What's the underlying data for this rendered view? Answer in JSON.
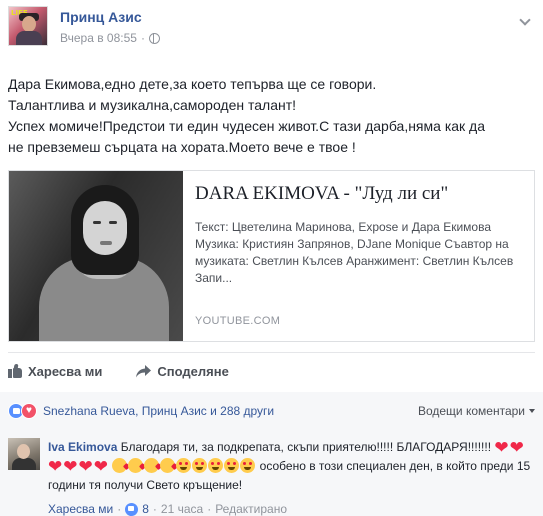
{
  "post": {
    "author": "Принц Азис",
    "timestamp": "Вчера в 08:55",
    "audience_icon": "globe-icon",
    "text_lines": [
      "Дара Екимова,едно дете,за което тепърва ще се говори.",
      "Талантлива и музикална,самороден талант!",
      "Успех момиче!Предстои ти един чудесен живот.С тази дарба,няма как да",
      "не превземеш сърцата на хората.Моето вече е твое !"
    ]
  },
  "link_card": {
    "title": "DARA EKIMOVA - \"Луд ли си\"",
    "description": "Текст: Цветелина Маринова, Expose и Дара Екимова Музика: Кристиян Запрянов, DJane Monique Съавтор на музиката: Светлин Кълсев Аранжимент: Светлин Кълсев Запи...",
    "source": "YOUTUBE.COM"
  },
  "actions": {
    "like": "Харесва ми",
    "share": "Споделяне"
  },
  "reactions": {
    "names": "Snezhana Rueva, Принц Азис и 288 други",
    "sort_label": "Водещи коментари"
  },
  "comment": {
    "author": "Iva Ekimova",
    "text_part1": "Благодаря ти, за подкрепата, скъпи приятелю!!!!! БЛАГОДАРЯ!!!!!!!",
    "hearts": "❤❤❤❤❤❤",
    "text_part2": "особено в този специален ден, в който преди 15 години тя получи Свето кръщение!",
    "like_label": "Харесва ми",
    "like_count": "8",
    "time": "21 часа",
    "edited": "Редактирано",
    "separator": "·"
  },
  "colors": {
    "link_blue": "#365899",
    "meta_gray": "#90949c",
    "heart_red": "#f02849",
    "like_blue": "#5890ff"
  }
}
